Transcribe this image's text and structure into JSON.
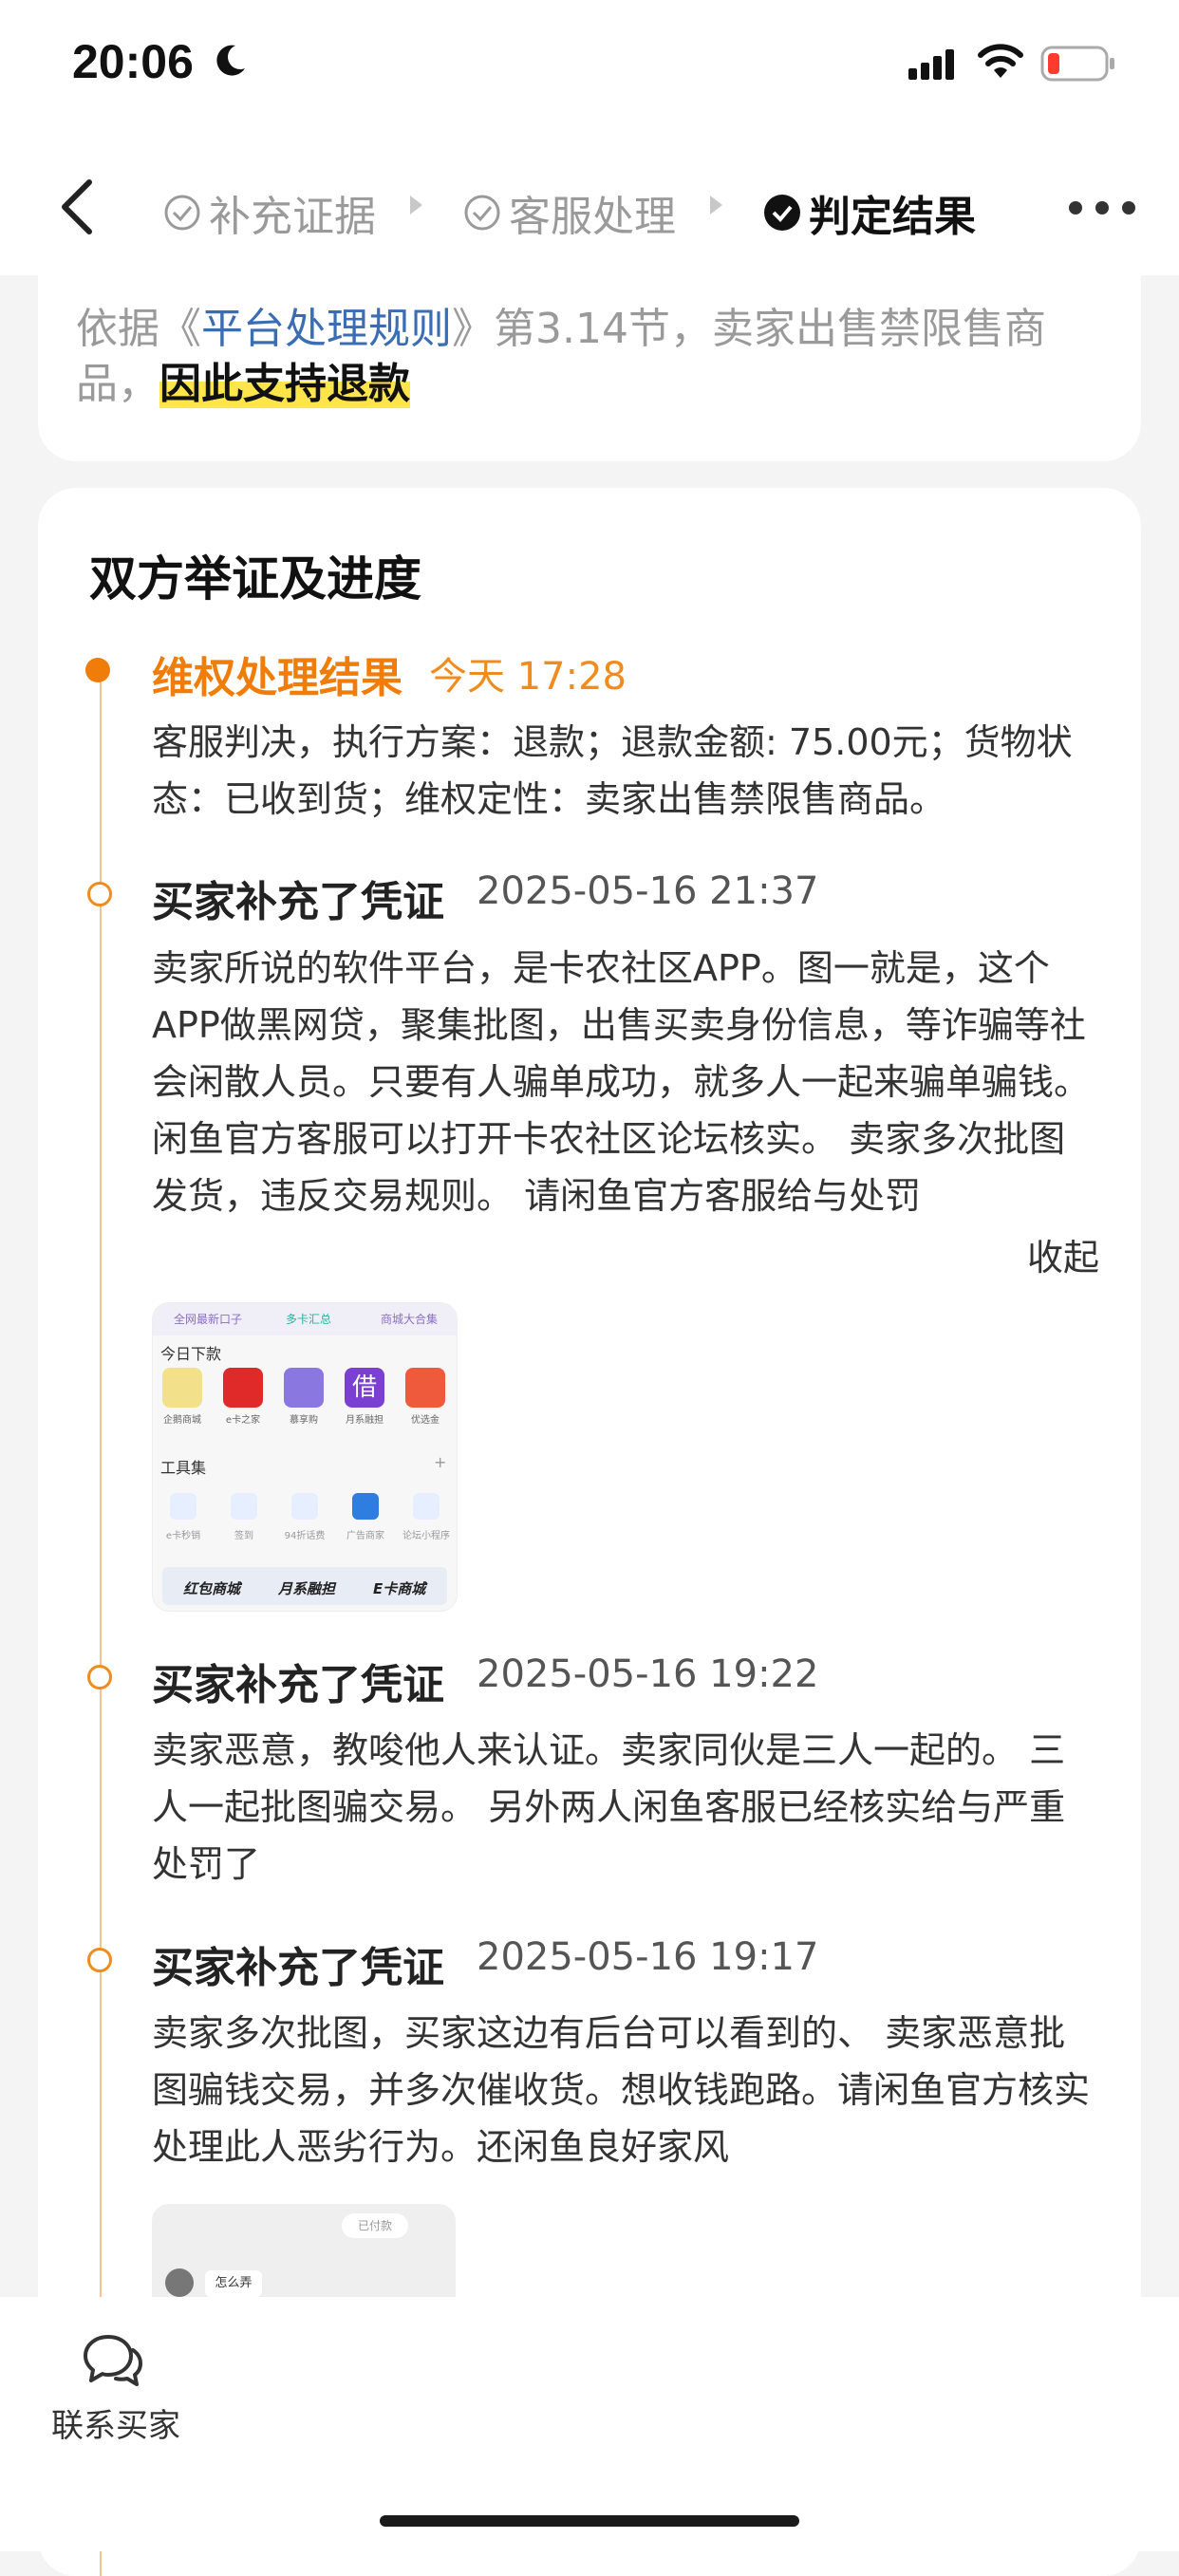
{
  "status_bar": {
    "time": "20:06"
  },
  "nav": {
    "steps": [
      {
        "label": "补充证据",
        "state": "done"
      },
      {
        "label": "客服处理",
        "state": "done"
      },
      {
        "label": "判定结果",
        "state": "current"
      }
    ]
  },
  "verdict": {
    "prefix": "依据《",
    "rule_link": "平台处理规则",
    "middle": "》第3.14节，卖家出售禁限售商品，",
    "highlight": "因此支持退款"
  },
  "evidence": {
    "title": "双方举证及进度",
    "events": [
      {
        "title": "维权处理结果",
        "time": "今天 17:28",
        "body": "客服判决，执行方案：退款；退款金额: 75.00元；货物状态：已收到货；维权定性：卖家出售禁限售商品。"
      },
      {
        "title": "买家补充了凭证",
        "time": "2025-05-16 21:37",
        "body": "卖家所说的软件平台，是卡农社区APP。图一就是，这个APP做黑网贷，聚集批图，出售买卖身份信息，等诈骗等社会闲散人员。只要有人骗单成功，就多人一起来骗单骗钱。 闲鱼官方客服可以打开卡农社区论坛核实。 卖家多次批图发货，违反交易规则。 请闲鱼官方客服给与处罚",
        "collapse": "收起"
      },
      {
        "title": "买家补充了凭证",
        "time": "2025-05-16 19:22",
        "body": "卖家恶意，教唆他人来认证。卖家同伙是三人一起的。 三人一起批图骗交易。 另外两人闲鱼客服已经核实给与严重处罚了"
      },
      {
        "title": "买家补充了凭证",
        "time": "2025-05-16 19:17",
        "body": "卖家多次批图，买家这边有后台可以看到的、 卖家恶意批图骗钱交易，并多次催收货。想收钱跑路。请闲鱼官方核实处理此人恶劣行为。还闲鱼良好家风"
      }
    ]
  },
  "screenshot1": {
    "tabs": [
      "全网最新口子",
      "多卡汇总",
      "商城大合集"
    ],
    "section1": "今日下款",
    "apps": [
      "企鹅商城",
      "e卡之家",
      "慕享购",
      "月系融担",
      "优选金"
    ],
    "section2": "工具集",
    "plus": "+",
    "tools": [
      "e卡秒销",
      "签到",
      "94折话费",
      "广告商家",
      "论坛小程序"
    ],
    "banner": [
      "红包商城",
      "月系融担",
      "E卡商城"
    ]
  },
  "screenshot2": {
    "paid": "已付款",
    "message": "怎么弄"
  },
  "bottom": {
    "contact_label": "联系买家"
  },
  "colors": {
    "accent": "#f07d0a",
    "link": "#3b6db3",
    "highlight": "#ffe54c"
  }
}
